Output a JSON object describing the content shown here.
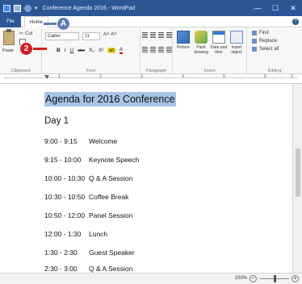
{
  "window": {
    "title": "Conference Agenda 2016 - WordPad",
    "controls": {
      "minimize": "—",
      "maximize": "☐",
      "close": "✕"
    }
  },
  "tabs": {
    "file": "File",
    "home": "Home"
  },
  "ribbon": {
    "clipboard": {
      "label": "Clipboard",
      "paste": "Paste",
      "cut": "Cut"
    },
    "font": {
      "label": "Font",
      "name": "Calibri",
      "size": "11",
      "grow": "A˄ A˅",
      "bold": "B",
      "italic": "I",
      "underline": "U",
      "strike": "abc",
      "subscript": "X₂",
      "superscript": "X²",
      "highlight": "ab",
      "color": "A"
    },
    "paragraph": {
      "label": "Paragraph"
    },
    "insert": {
      "label": "Insert",
      "picture": "Picture",
      "paint": "Paint drawing",
      "datetime": "Date and time",
      "object": "Insert object"
    },
    "editing": {
      "label": "Editing",
      "find": "Find",
      "replace": "Replace",
      "select_all": "Select all"
    }
  },
  "callouts": {
    "a": "A",
    "two": "2"
  },
  "ruler": {
    "marks": [
      "1",
      "2",
      "3",
      "4",
      "5",
      "6",
      "2"
    ]
  },
  "document": {
    "heading": "Agenda for 2016 Conference",
    "day": "Day 1",
    "rows": [
      {
        "time": "9:00 - 9:15",
        "event": "Welcome"
      },
      {
        "time": "9:15 - 10:00",
        "event": "Keynote Speech"
      },
      {
        "time": "10:00 - 10:30",
        "event": "Q & A Session"
      },
      {
        "time": "10:30 - 10:50",
        "event": "Coffee Break"
      },
      {
        "time": "10:50 - 12:00",
        "event": "Panel Session"
      },
      {
        "time": "12:00 - 1:30",
        "event": "Lunch"
      },
      {
        "time": "1:30 - 2:30",
        "event": "Guest Speaker"
      },
      {
        "time": "2:30 - 3:00",
        "event": "Q & A Session"
      }
    ]
  },
  "status": {
    "zoom": "100%",
    "minus": "−",
    "plus": "+"
  }
}
